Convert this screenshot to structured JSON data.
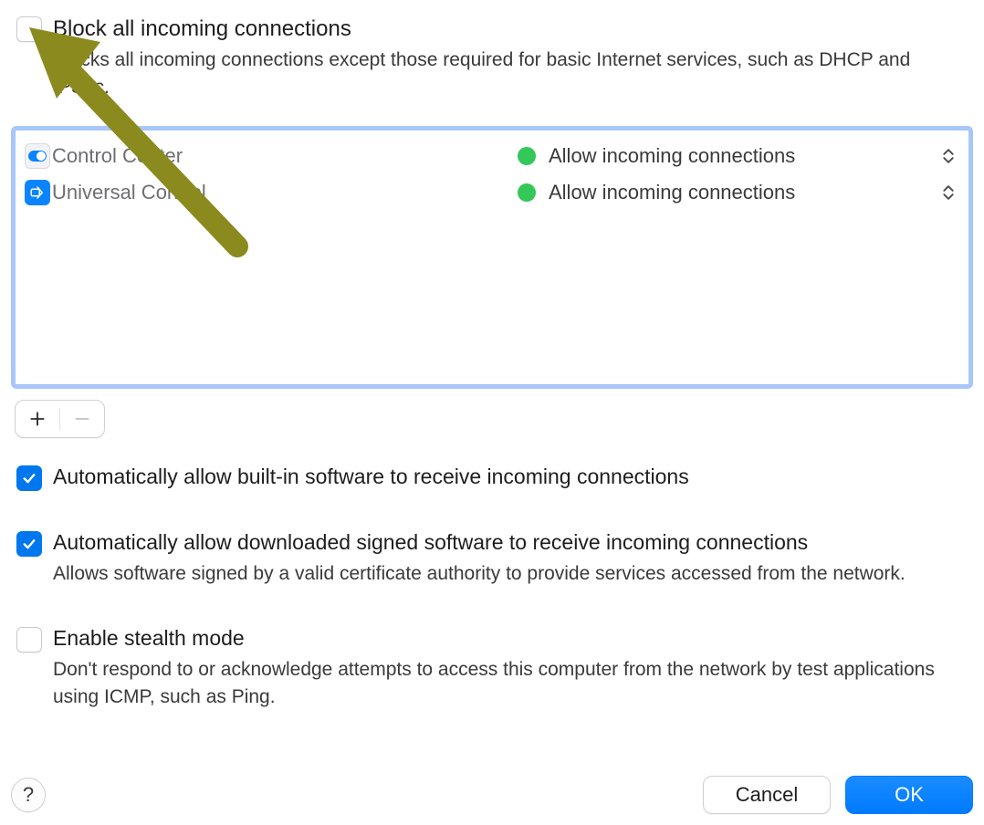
{
  "blockAll": {
    "checked": false,
    "title": "Block all incoming connections",
    "description": "Blocks all incoming connections except those required for basic Internet services, such as DHCP and IPSec."
  },
  "appList": {
    "rows": [
      {
        "iconType": "cc",
        "name": "Control Center",
        "statusText": "Allow incoming connections",
        "statusColor": "#34c759"
      },
      {
        "iconType": "uc",
        "name": "Universal Control",
        "statusText": "Allow incoming connections",
        "statusColor": "#34c759"
      }
    ]
  },
  "addRemove": {
    "addEnabled": true,
    "removeEnabled": false
  },
  "autoBuiltIn": {
    "checked": true,
    "title": "Automatically allow built-in software to receive incoming connections"
  },
  "autoSigned": {
    "checked": true,
    "title": "Automatically allow downloaded signed software to receive incoming connections",
    "description": "Allows software signed by a valid certificate authority to provide services accessed from the network."
  },
  "stealth": {
    "checked": false,
    "title": "Enable stealth mode",
    "description": "Don't respond to or acknowledge attempts to access this computer from the network by test applications using ICMP, such as Ping."
  },
  "footer": {
    "help": "?",
    "cancel": "Cancel",
    "ok": "OK"
  },
  "annotation": {
    "arrowColor": "#8a8a1f"
  }
}
